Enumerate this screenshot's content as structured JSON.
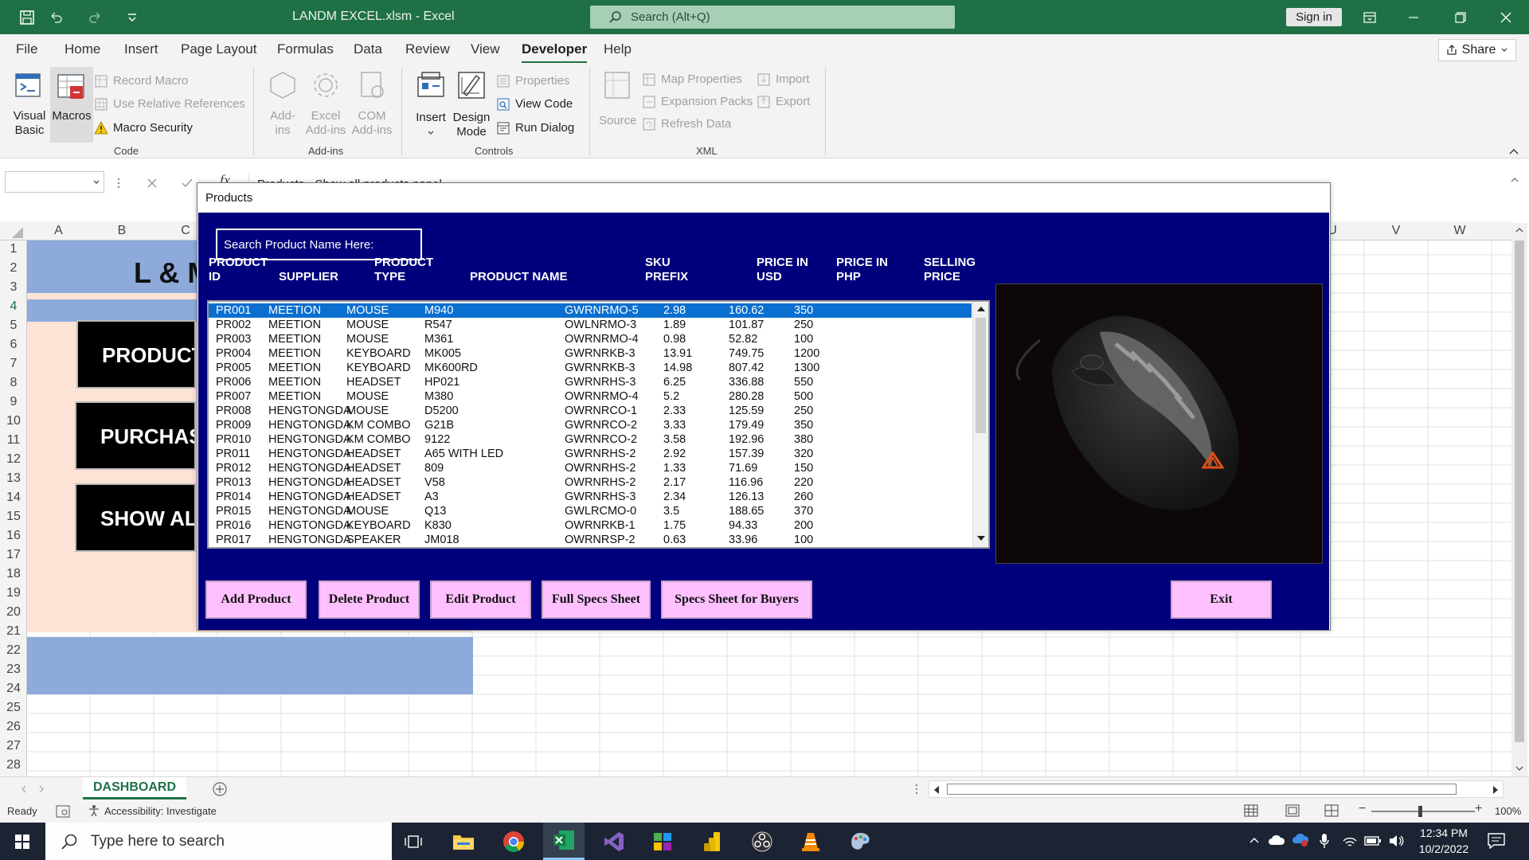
{
  "app": {
    "doc_title": "LANDM EXCEL.xlsm  -  Excel",
    "search_placeholder": "Search (Alt+Q)",
    "signin": "Sign in"
  },
  "menu": {
    "tabs": [
      "File",
      "Home",
      "Insert",
      "Page Layout",
      "Formulas",
      "Data",
      "Review",
      "View",
      "Developer",
      "Help"
    ],
    "active": "Developer",
    "share": "Share"
  },
  "ribbon": {
    "code": {
      "visual_basic": [
        "Visual",
        "Basic"
      ],
      "macros": "Macros",
      "record_macro": "Record Macro",
      "use_relative": "Use Relative References",
      "macro_security": "Macro Security",
      "group": "Code"
    },
    "addins": {
      "addins": [
        "Add-",
        "ins"
      ],
      "excel_addins": [
        "Excel",
        "Add-ins"
      ],
      "com_addins": [
        "COM",
        "Add-ins"
      ],
      "group": "Add-ins"
    },
    "controls": {
      "insert": "Insert",
      "design_mode": [
        "Design",
        "Mode"
      ],
      "properties": "Properties",
      "view_code": "View Code",
      "run_dialog": "Run Dialog",
      "group": "Controls"
    },
    "xml": {
      "source": "Source",
      "map_properties": "Map Properties",
      "expansion_packs": "Expansion Packs",
      "refresh_data": "Refresh Data",
      "import": "Import",
      "export": "Export",
      "group": "XML"
    }
  },
  "formula_bar": {
    "fx": "fx",
    "content": "Products - Show all products panel"
  },
  "sheet": {
    "columns": [
      "A",
      "B",
      "C",
      "U",
      "V",
      "W"
    ],
    "rows": [
      "1",
      "2",
      "3",
      "4",
      "5",
      "6",
      "7",
      "8",
      "9",
      "10",
      "11",
      "12",
      "13",
      "14",
      "15",
      "16",
      "17",
      "18",
      "19",
      "20",
      "21",
      "22",
      "23",
      "24",
      "25",
      "26",
      "27",
      "28"
    ],
    "title_fragment": "L & M",
    "buttons": [
      "PRODUCT",
      "PURCHASI",
      "SHOW AL"
    ],
    "tab": "DASHBOARD"
  },
  "dialog": {
    "title": "Products",
    "search_label": "Search Product Name Here:",
    "headers": {
      "product_id": [
        "PRODUCT",
        "ID"
      ],
      "supplier": "SUPPLIER",
      "product_type": [
        "PRODUCT",
        "TYPE"
      ],
      "product_name": "PRODUCT NAME",
      "sku_prefix": [
        "SKU",
        "PREFIX"
      ],
      "price_usd": [
        "PRICE IN",
        "USD"
      ],
      "price_php": [
        "PRICE IN",
        "PHP"
      ],
      "selling_price": [
        "SELLING",
        "PRICE"
      ]
    },
    "rows": [
      [
        "PR001",
        "MEETION",
        "MOUSE",
        "M940",
        "GWRNRMO-5",
        "2.98",
        "160.62",
        "350"
      ],
      [
        "PR002",
        "MEETION",
        "MOUSE",
        "R547",
        "OWLNRMO-3",
        "1.89",
        "101.87",
        "250"
      ],
      [
        "PR003",
        "MEETION",
        "MOUSE",
        "M361",
        "OWRNRMO-4",
        "0.98",
        "52.82",
        "100"
      ],
      [
        "PR004",
        "MEETION",
        "KEYBOARD",
        "MK005",
        "GWRNRKB-3",
        "13.91",
        "749.75",
        "1200"
      ],
      [
        "PR005",
        "MEETION",
        "KEYBOARD",
        "MK600RD",
        "GWRNRKB-3",
        "14.98",
        "807.42",
        "1300"
      ],
      [
        "PR006",
        "MEETION",
        "HEADSET",
        "HP021",
        "GWRNRHS-3",
        "6.25",
        "336.88",
        "550"
      ],
      [
        "PR007",
        "MEETION",
        "MOUSE",
        "M380",
        "OWRNRMO-4",
        "5.2",
        "280.28",
        "500"
      ],
      [
        "PR008",
        "HENGTONGDA",
        "MOUSE",
        "D5200",
        "OWRNRCO-1",
        "2.33",
        "125.59",
        "250"
      ],
      [
        "PR009",
        "HENGTONGDA",
        "KM COMBO",
        "G21B",
        "GWRNRCO-2",
        "3.33",
        "179.49",
        "350"
      ],
      [
        "PR010",
        "HENGTONGDA",
        "KM COMBO",
        "9122",
        "GWRNRCO-2",
        "3.58",
        "192.96",
        "380"
      ],
      [
        "PR011",
        "HENGTONGDA",
        "HEADSET",
        "A65 WITH LED",
        "GWRNRHS-2",
        "2.92",
        "157.39",
        "320"
      ],
      [
        "PR012",
        "HENGTONGDA",
        "HEADSET",
        "809",
        "OWRNRHS-2",
        "1.33",
        "71.69",
        "150"
      ],
      [
        "PR013",
        "HENGTONGDA",
        "HEADSET",
        "V58",
        "OWRNRHS-2",
        "2.17",
        "116.96",
        "220"
      ],
      [
        "PR014",
        "HENGTONGDA",
        "HEADSET",
        "A3",
        "GWRNRHS-3",
        "2.34",
        "126.13",
        "260"
      ],
      [
        "PR015",
        "HENGTONGDA",
        "MOUSE",
        "Q13",
        "GWLRCMO-0",
        "3.5",
        "188.65",
        "370"
      ],
      [
        "PR016",
        "HENGTONGDA",
        "KEYBOARD",
        "K830",
        "OWRNRKB-1",
        "1.75",
        "94.33",
        "200"
      ],
      [
        "PR017",
        "HENGTONGDA",
        "SPEAKER",
        "JM018",
        "OWRNRSP-2",
        "0.63",
        "33.96",
        "100"
      ]
    ],
    "selected_row": 0,
    "buttons": {
      "add": "Add Product",
      "delete": "Delete Product",
      "edit": "Edit Product",
      "full_specs": "Full Specs Sheet",
      "specs_buyers": "Specs Sheet for Buyers",
      "exit": "Exit"
    },
    "image_icon": "gaming-mouse-image"
  },
  "status": {
    "ready": "Ready",
    "accessibility": "Accessibility: Investigate",
    "zoom": "100%"
  },
  "taskbar": {
    "search_placeholder": "Type here to search",
    "time": "12:34 PM",
    "date": "10/2/2022"
  },
  "colors": {
    "excel_green": "#1f7145",
    "dialog_bg": "#00007c",
    "button_pink": "#ffc0ff",
    "selection_blue": "#0b6fd0",
    "sheet_peach": "#fde3d6",
    "sheet_blue": "#8eaadb"
  }
}
